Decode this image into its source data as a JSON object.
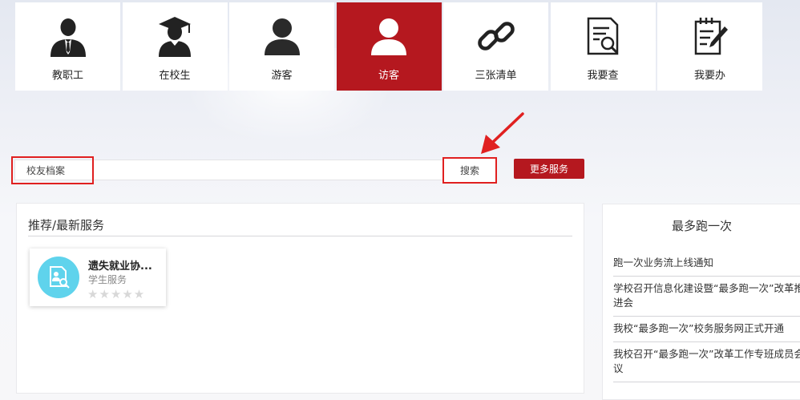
{
  "nav": {
    "tiles": [
      {
        "label": "教职工",
        "icon": "staff-icon"
      },
      {
        "label": "在校生",
        "icon": "graduate-icon"
      },
      {
        "label": "游客",
        "icon": "tourist-icon"
      },
      {
        "label": "访客",
        "icon": "visitor-icon",
        "active": true
      },
      {
        "label": "三张清单",
        "icon": "link-icon"
      },
      {
        "label": "我要查",
        "icon": "search-document-icon"
      },
      {
        "label": "我要办",
        "icon": "edit-document-icon"
      }
    ],
    "active_color": "#b5181f"
  },
  "search": {
    "value": "校友档案",
    "button_label": "搜索",
    "more_label": "更多服务"
  },
  "recommend": {
    "title": "推荐/最新服务",
    "items": [
      {
        "name": "遗失就业协...",
        "category": "学生服务",
        "stars": "★★★★★",
        "icon": "document-search-icon"
      }
    ]
  },
  "pao": {
    "title": "最多跑一次",
    "items": [
      "跑一次业务流上线通知",
      "学校召开信息化建设暨“最多跑一次”改革推进会",
      "我校“最多跑一次”校务服务网正式开通",
      "我校召开“最多跑一次”改革工作专班成员会议"
    ]
  },
  "annotation_color": "#e02020"
}
